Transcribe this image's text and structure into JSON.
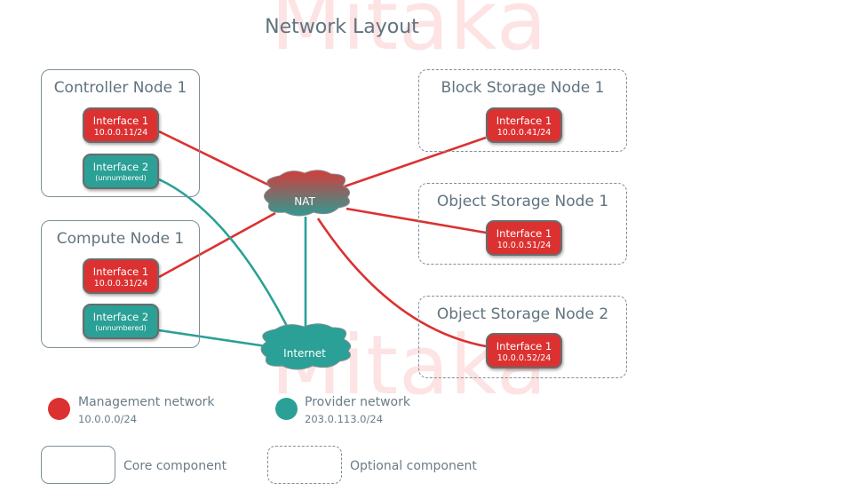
{
  "title": "Network Layout",
  "watermark": "Mitaka",
  "colors": {
    "management": "#dc3131",
    "provider": "#2aa096",
    "border": "#7d8f98"
  },
  "nodes": [
    {
      "name": "Controller Node 1",
      "type": "core",
      "interfaces": [
        {
          "name": "Interface 1",
          "addr": "10.0.0.11/24",
          "network": "management"
        },
        {
          "name": "Interface 2",
          "addr": "(unnumbered)",
          "network": "provider"
        }
      ]
    },
    {
      "name": "Compute Node 1",
      "type": "core",
      "interfaces": [
        {
          "name": "Interface 1",
          "addr": "10.0.0.31/24",
          "network": "management"
        },
        {
          "name": "Interface 2",
          "addr": "(unnumbered)",
          "network": "provider"
        }
      ]
    },
    {
      "name": "Block Storage Node 1",
      "type": "optional",
      "interfaces": [
        {
          "name": "Interface 1",
          "addr": "10.0.0.41/24",
          "network": "management"
        }
      ]
    },
    {
      "name": "Object Storage Node 1",
      "type": "optional",
      "interfaces": [
        {
          "name": "Interface 1",
          "addr": "10.0.0.51/24",
          "network": "management"
        }
      ]
    },
    {
      "name": "Object Storage Node 2",
      "type": "optional",
      "interfaces": [
        {
          "name": "Interface 1",
          "addr": "10.0.0.52/24",
          "network": "management"
        }
      ]
    }
  ],
  "clouds": {
    "nat": "NAT",
    "internet": "Internet"
  },
  "legend": {
    "management": {
      "label": "Management network",
      "subnet": "10.0.0.0/24"
    },
    "provider": {
      "label": "Provider network",
      "subnet": "203.0.113.0/24"
    },
    "core": "Core component",
    "optional": "Optional component"
  }
}
